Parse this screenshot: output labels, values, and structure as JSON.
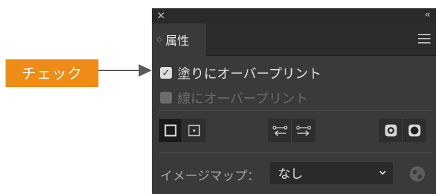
{
  "callout": {
    "label": "チェック",
    "color": "#ee8c16"
  },
  "panel": {
    "close_icon": "×",
    "collapse_icon": "‹‹",
    "tab_label": "属性",
    "tab_arrows": "◇",
    "options": [
      {
        "label": "塗りにオーバープリント",
        "checked": true,
        "enabled": true
      },
      {
        "label": "線にオーバープリント",
        "checked": false,
        "enabled": false
      }
    ],
    "imagemap": {
      "label": "イメージマップ：",
      "value": "なし"
    }
  }
}
